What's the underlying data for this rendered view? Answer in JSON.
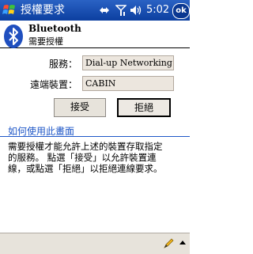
{
  "titlebar": {
    "title": "授權要求",
    "clock": "5:02",
    "ok_label": "ok",
    "icons": {
      "start": "windows-flag-icon",
      "connectivity": "connectivity-icon",
      "signal": "signal-icon",
      "volume": "volume-icon"
    }
  },
  "header": {
    "app_name": "Bluetooth",
    "subtitle": "需要授權",
    "logo": "bluetooth-icon"
  },
  "form": {
    "service_label": "服務：",
    "service_value": "Dial-up Networking",
    "device_label": "遠端裝置：",
    "device_value": "CABIN"
  },
  "buttons": {
    "accept": "接受",
    "reject": "拒絕"
  },
  "help": {
    "title": "如何使用此畫面",
    "body_line1": "需要授權才能允許上述的裝置存取指定",
    "body_line2": "的服務。 點選「接受」以允許裝置連",
    "body_line3": "線，或點選「拒絕」以拒絕連線要求。"
  },
  "bottombar": {
    "icons": {
      "input": "pencil-icon",
      "sip": "up-arrow-icon"
    }
  },
  "colors": {
    "titlebar": "#0c3fa0",
    "accent_link": "#1f57c7",
    "field_bg": "#ece6de",
    "bar_bg": "#e7e3db"
  }
}
